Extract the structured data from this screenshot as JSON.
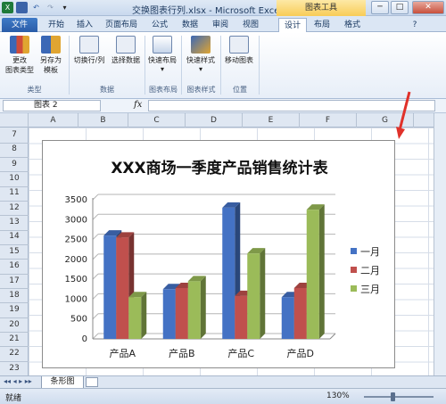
{
  "window": {
    "title": "交换图表行列.xlsx - Microsoft Excel",
    "context_tab": "图表工具",
    "buttons": [
      "─",
      "□",
      "✕"
    ]
  },
  "tabs": [
    "文件",
    "开始",
    "插入",
    "页面布局",
    "公式",
    "数据",
    "审阅",
    "视图",
    "设计",
    "布局",
    "格式"
  ],
  "active_tab": "设计",
  "ribbon": {
    "buttons": [
      {
        "label1": "更改",
        "label2": "图表类型"
      },
      {
        "label1": "另存为",
        "label2": "模板"
      },
      {
        "label1": "切换行/列",
        "label2": ""
      },
      {
        "label1": "选择数据",
        "label2": ""
      },
      {
        "label1": "快速布局",
        "label2": "▾"
      },
      {
        "label1": "快速样式",
        "label2": "▾"
      },
      {
        "label1": "移动图表",
        "label2": ""
      }
    ],
    "groups": [
      "类型",
      "数据",
      "图表布局",
      "图表样式",
      "位置"
    ]
  },
  "formula_bar": {
    "name_box": "图表 2",
    "fx": "fx",
    "value": ""
  },
  "columns": [
    "A",
    "B",
    "C",
    "D",
    "E",
    "F",
    "G"
  ],
  "rows": [
    "7",
    "8",
    "9",
    "10",
    "11",
    "12",
    "13",
    "14",
    "15",
    "16",
    "17",
    "18",
    "19",
    "20",
    "21",
    "22",
    "23"
  ],
  "sheet_tab": "条形图",
  "status": "就绪",
  "zoom": "130%",
  "colors": {
    "series1": "#4472c4",
    "series2": "#c0504d",
    "series3": "#9bbb59",
    "arrow": "#e0312a"
  },
  "chart_data": {
    "type": "bar",
    "title": "XXX商场一季度产品销售统计表",
    "categories": [
      "产品A",
      "产品B",
      "产品C",
      "产品D"
    ],
    "series": [
      {
        "name": "一月",
        "values": [
          2600,
          1250,
          3300,
          1050
        ]
      },
      {
        "name": "二月",
        "values": [
          2550,
          1280,
          1080,
          1280
        ]
      },
      {
        "name": "三月",
        "values": [
          1050,
          1450,
          2150,
          3250
        ]
      }
    ],
    "ylim": [
      0,
      3500
    ],
    "yticks": [
      0,
      500,
      1000,
      1500,
      2000,
      2500,
      3000,
      3500
    ],
    "grid": true,
    "legend": "right"
  }
}
